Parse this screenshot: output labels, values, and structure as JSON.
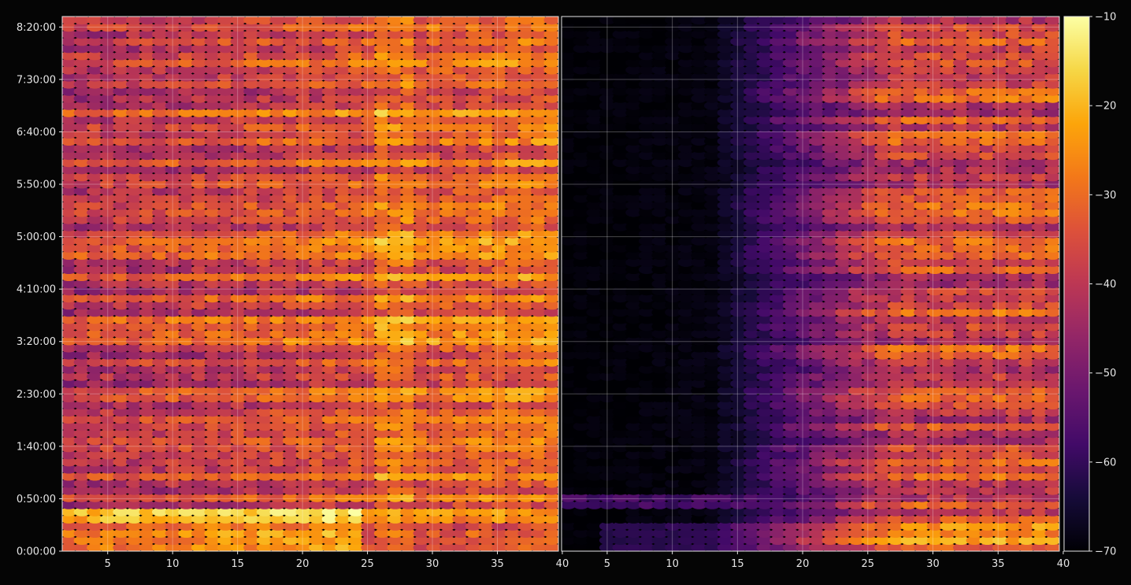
{
  "chart_data": {
    "type": "heatmap",
    "title": "",
    "background": "#050505",
    "colormap": "inferno",
    "grid": true,
    "panels": [
      {
        "name": "",
        "x_range": [
          1.5,
          39.7
        ],
        "x_ticks": [
          5,
          10,
          15,
          20,
          25,
          30,
          35,
          40
        ],
        "profile": "bright_band_then_full",
        "seed": 11
      },
      {
        "name": "",
        "x_range": [
          1.5,
          39.7
        ],
        "x_ticks": [
          5,
          10,
          15,
          20,
          25,
          30,
          35,
          40
        ],
        "profile": "dark_left_bright_right",
        "seed": 29
      }
    ],
    "y_axis": {
      "range_seconds": [
        0,
        30600
      ],
      "ticks": [
        "0:00:00",
        "0:50:00",
        "1:40:00",
        "2:30:00",
        "3:20:00",
        "4:10:00",
        "5:00:00",
        "5:50:00",
        "6:40:00",
        "7:30:00",
        "8:20:00"
      ]
    },
    "colorbar": {
      "range": [
        -70,
        -10
      ],
      "ticks": [
        -10,
        -20,
        -30,
        -40,
        -50,
        -60,
        -70
      ]
    },
    "summary_levels": {
      "left_panel_typical": -38,
      "left_panel_peak": -12,
      "right_panel_left_half": -68,
      "right_panel_right_half": -42
    }
  }
}
